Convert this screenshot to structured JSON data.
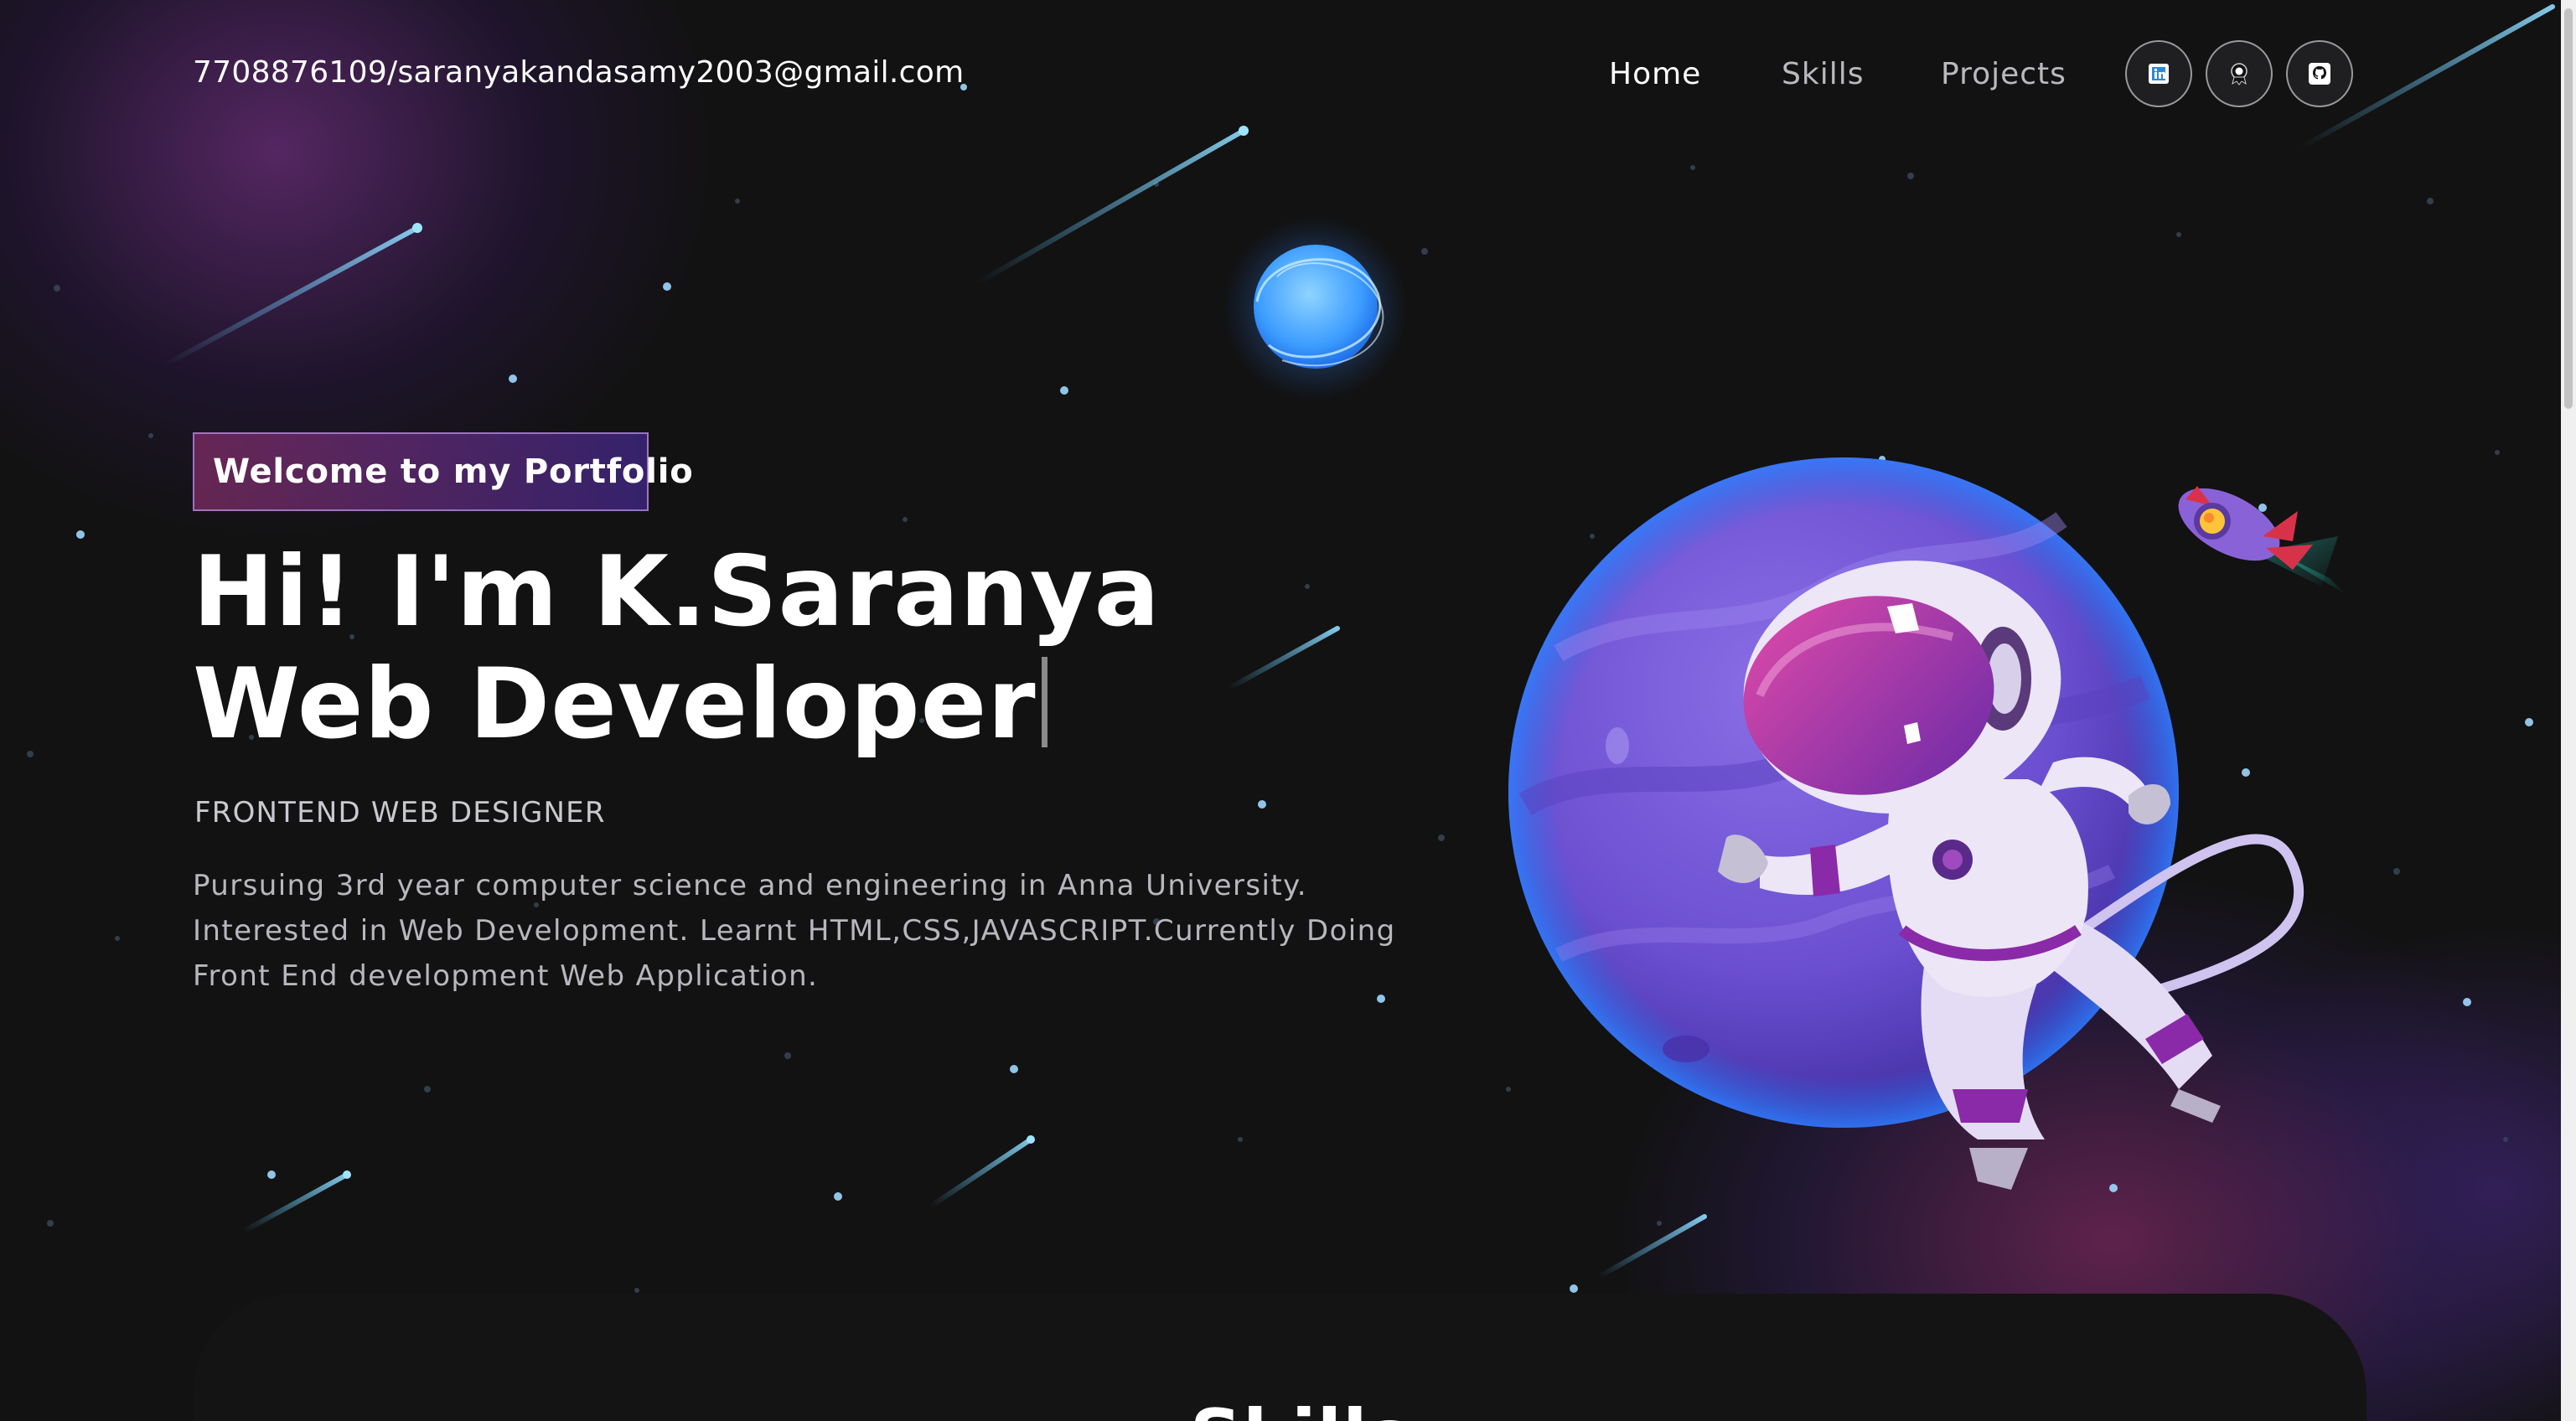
{
  "header": {
    "contact": "7708876109/saranyakandasamy2003@gmail.com",
    "nav": [
      {
        "label": "Home",
        "active": true
      },
      {
        "label": "Skills",
        "active": false
      },
      {
        "label": "Projects",
        "active": false
      }
    ],
    "social_icons": [
      "linkedin-icon",
      "hackerrank-badge-icon",
      "github-icon"
    ]
  },
  "hero": {
    "tagline": "Welcome to my Portfolio",
    "headline": "Hi! I'm K.Saranya Web Developer",
    "subtitle": "FRONTEND WEB DESIGNER",
    "description": "Pursuing 3rd year computer science and engineering in Anna University. Interested in Web Development. Learnt HTML,CSS,JAVASCRIPT.Currently Doing Front End development Web Application.",
    "illustration": "astronaut-planet-illustration"
  },
  "skills_section": {
    "heading": "Skills"
  },
  "colors": {
    "background": "#121212",
    "accent_pink": "#aa367c",
    "accent_purple": "#4a2fbd",
    "planet": "#6a4fd0",
    "text_white": "#ffffff",
    "text_muted": "#b7b7bd"
  }
}
